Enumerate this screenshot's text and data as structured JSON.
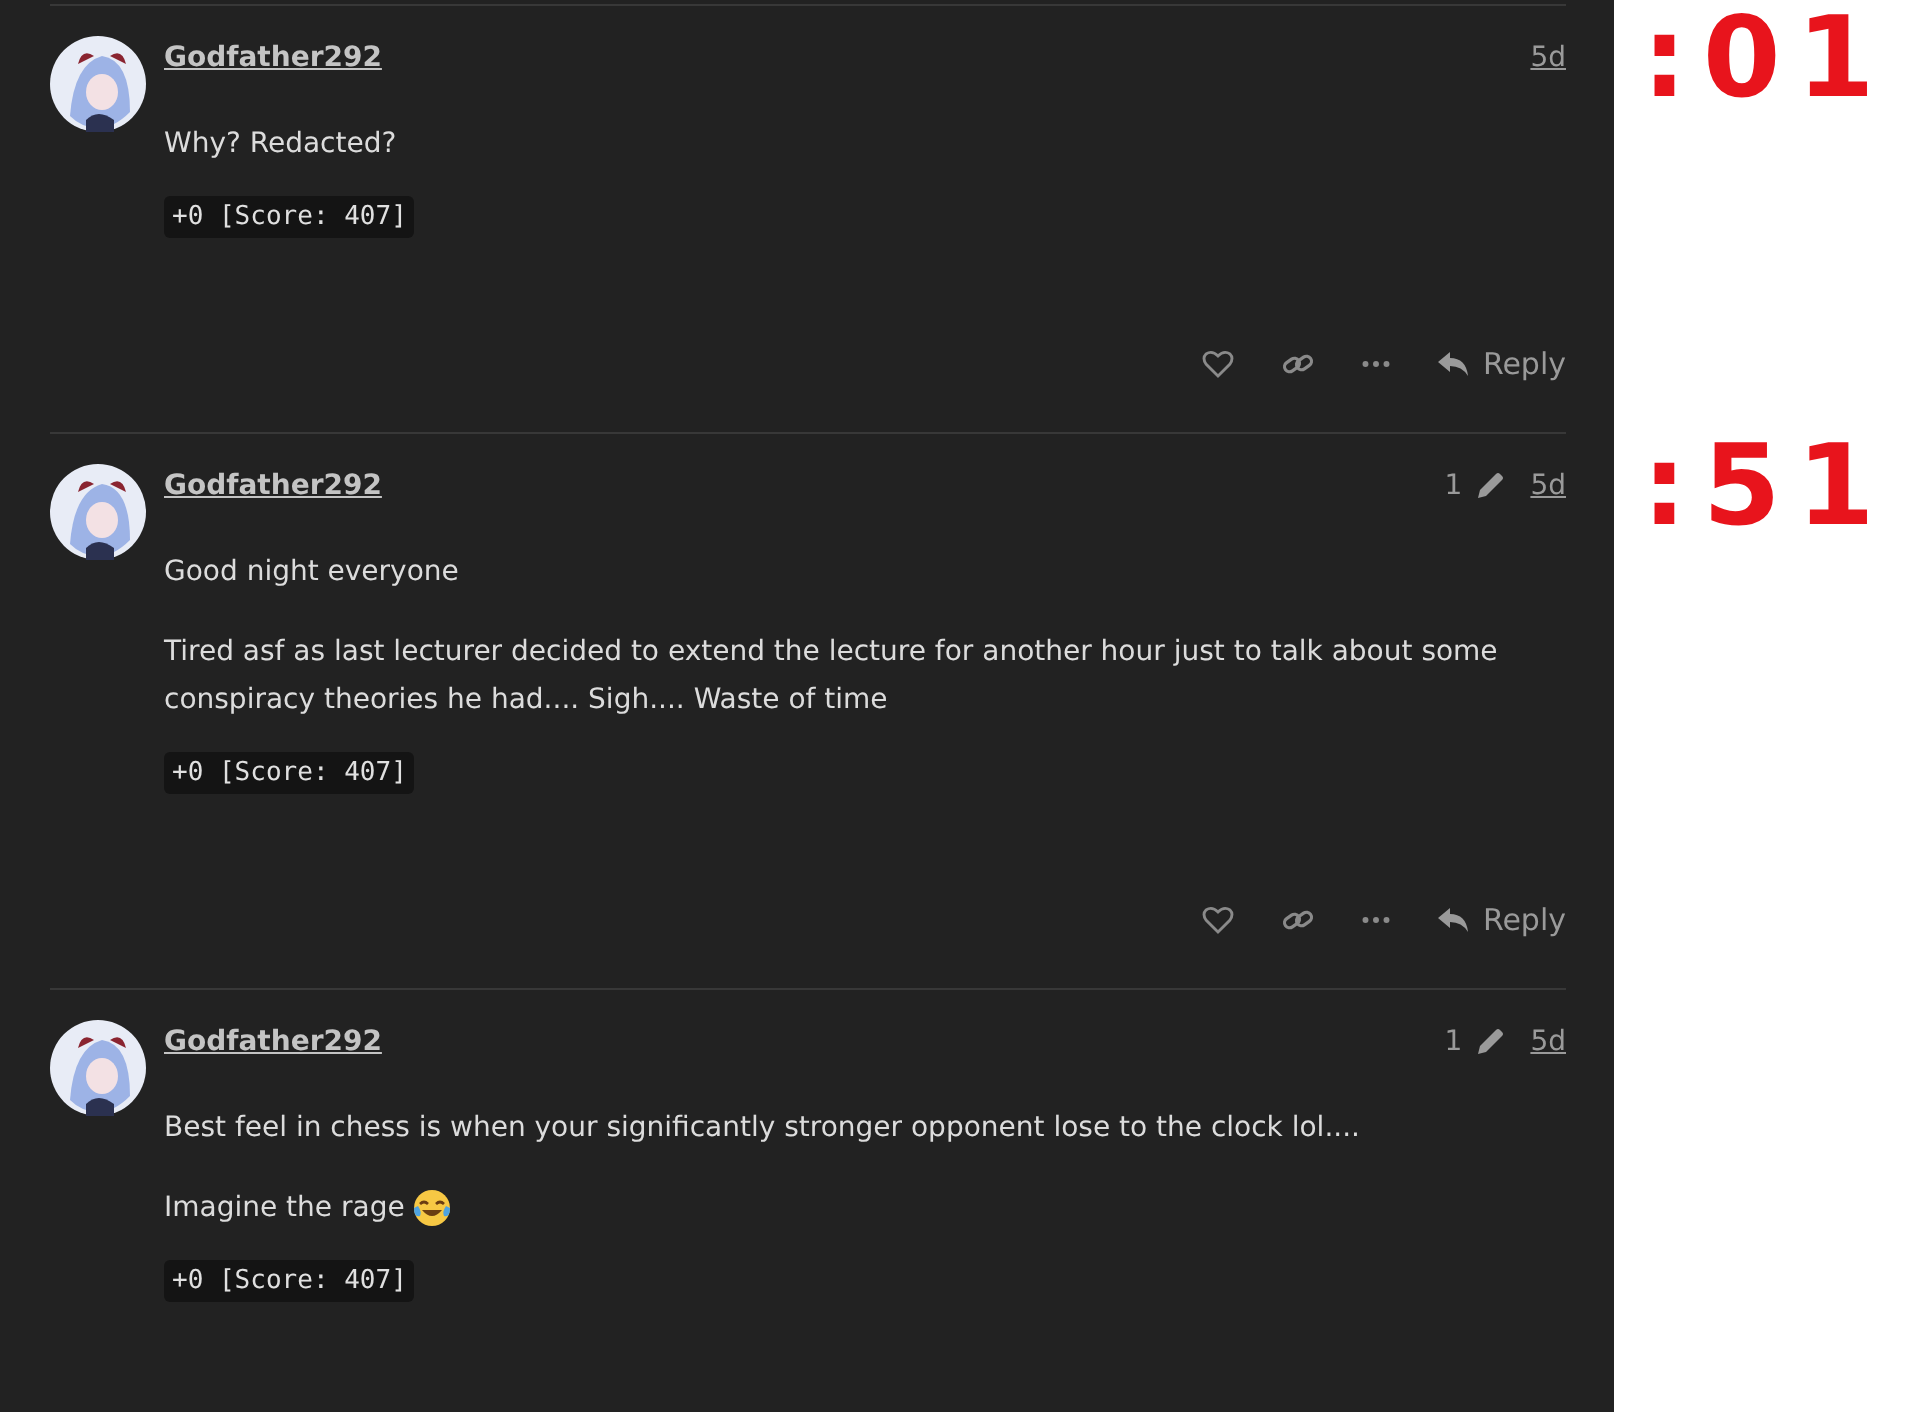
{
  "posts": [
    {
      "username": "Godfather292",
      "age": "5d",
      "paragraphs": [
        "Why? Redacted?"
      ],
      "score": "+0 [Score: 407]",
      "actions": {
        "reply": "Reply"
      },
      "annotation": ":01"
    },
    {
      "username": "Godfather292",
      "edits": "1",
      "age": "5d",
      "paragraphs": [
        "Good night everyone",
        "Tired asf as last lecturer decided to extend the lecture for another hour just to talk about some conspiracy theories he had.... Sigh.... Waste of time"
      ],
      "score": "+0 [Score: 407]",
      "actions": {
        "reply": "Reply"
      },
      "annotation": ":51"
    },
    {
      "username": "Godfather292",
      "edits": "1",
      "age": "5d",
      "paragraphs": [
        "Best feel in chess is when your significantly stronger opponent lose to the clock lol....",
        "Imagine the rage"
      ],
      "ends_with_emoji": true,
      "score": "+0 [Score: 407]"
    }
  ]
}
